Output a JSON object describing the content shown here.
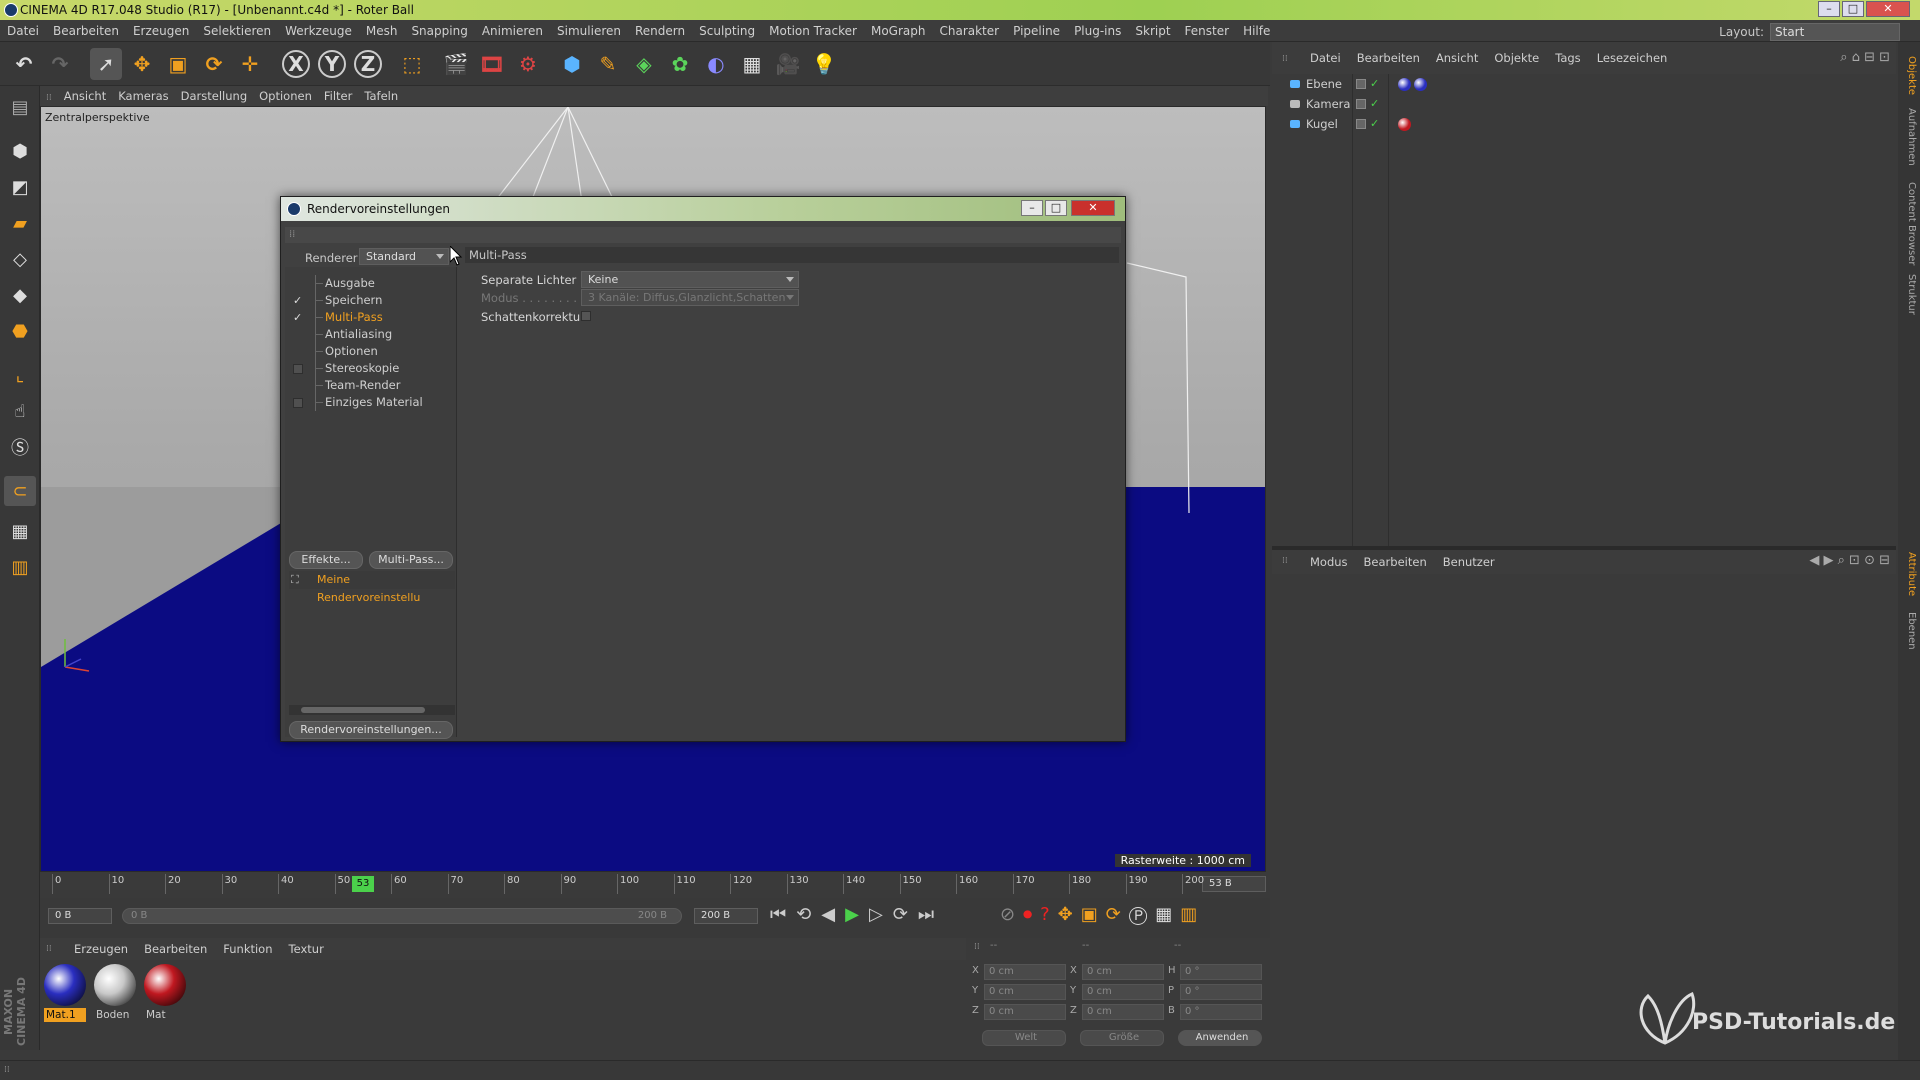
{
  "window": {
    "title": "CINEMA 4D R17.048 Studio (R17) - [Unbenannt.c4d *] - Roter Ball",
    "minimize": "–",
    "maximize": "□",
    "close": "✕"
  },
  "menubar": [
    "Datei",
    "Bearbeiten",
    "Erzeugen",
    "Selektieren",
    "Werkzeuge",
    "Mesh",
    "Snapping",
    "Animieren",
    "Simulieren",
    "Rendern",
    "Sculpting",
    "Motion Tracker",
    "MoGraph",
    "Charakter",
    "Pipeline",
    "Plug-ins",
    "Skript",
    "Fenster",
    "Hilfe"
  ],
  "layout": {
    "label": "Layout:",
    "value": "Start"
  },
  "toolbar": {
    "x_label": "X",
    "y_label": "Y",
    "z_label": "Z"
  },
  "viewport": {
    "menu": [
      "Ansicht",
      "Kameras",
      "Darstellung",
      "Optionen",
      "Filter",
      "Tafeln"
    ],
    "label": "Zentralperspektive",
    "grid_info": "Rasterweite : 1000 cm"
  },
  "dialog": {
    "title": "Rendervoreinstellungen",
    "renderer_label": "Renderer",
    "renderer_value": "Standard",
    "section_title": "Multi-Pass",
    "items": [
      {
        "label": "Ausgabe",
        "mark": ""
      },
      {
        "label": "Speichern",
        "mark": "✓"
      },
      {
        "label": "Multi-Pass",
        "mark": "✓"
      },
      {
        "label": "Antialiasing",
        "mark": ""
      },
      {
        "label": "Optionen",
        "mark": ""
      },
      {
        "label": "Stereoskopie",
        "mark": "box"
      },
      {
        "label": "Team-Render",
        "mark": ""
      },
      {
        "label": "Einziges Material",
        "mark": "box"
      }
    ],
    "effects_button": "Effekte...",
    "multipass_button": "Multi-Pass...",
    "preset_name": "Meine Rendervoreinstellu",
    "settings_button": "Rendervoreinstellungen...",
    "props": {
      "separate_lights_label": "Separate Lichter",
      "separate_lights_value": "Keine",
      "mode_label": "Modus . . . . . . . . .",
      "mode_value": "3 Kanäle: Diffus,Glanzlicht,Schatten",
      "shadow_label": "Schattenkorrektur"
    }
  },
  "objects": {
    "menu": [
      "Datei",
      "Bearbeiten",
      "Ansicht",
      "Objekte",
      "Tags",
      "Lesezeichen"
    ],
    "rows": [
      "Ebene",
      "Kamera",
      "Kugel"
    ]
  },
  "attributes": {
    "menu": [
      "Modus",
      "Bearbeiten",
      "Benutzer"
    ]
  },
  "side_tabs": [
    "Objekte",
    "Aufnahmen",
    "Content Browser",
    "Struktur",
    "Attribute",
    "Ebenen"
  ],
  "timeline": {
    "ticks": [
      "0",
      "10",
      "20",
      "30",
      "40",
      "50",
      "60",
      "70",
      "80",
      "90",
      "100",
      "110",
      "120",
      "130",
      "140",
      "150",
      "160",
      "170",
      "180",
      "190",
      "200"
    ],
    "current": "53",
    "current_field": "53 B"
  },
  "transport": {
    "start": "0 B",
    "range_start": "0 B",
    "range_end": "200 B",
    "end": "200 B"
  },
  "materials": {
    "menu": [
      "Erzeugen",
      "Bearbeiten",
      "Funktion",
      "Textur"
    ],
    "items": [
      {
        "name": "Mat.1",
        "color": "#2a2ec0"
      },
      {
        "name": "Boden",
        "color": "#c8c8c8"
      },
      {
        "name": "Mat",
        "color": "#c01820"
      }
    ]
  },
  "coords": {
    "head": [
      "--",
      "--",
      "--"
    ],
    "rows": [
      {
        "a": "X",
        "av": "0 cm",
        "b": "X",
        "bv": "0 cm",
        "c": "H",
        "cv": "0 °"
      },
      {
        "a": "Y",
        "av": "0 cm",
        "b": "Y",
        "bv": "0 cm",
        "c": "P",
        "cv": "0 °"
      },
      {
        "a": "Z",
        "av": "0 cm",
        "b": "Z",
        "bv": "0 cm",
        "c": "B",
        "cv": "0 °"
      }
    ],
    "world": "Welt",
    "size": "Größe",
    "apply": "Anwenden"
  },
  "watermark": "PSD-Tutorials.de",
  "brand": "MAXON CINEMA 4D"
}
